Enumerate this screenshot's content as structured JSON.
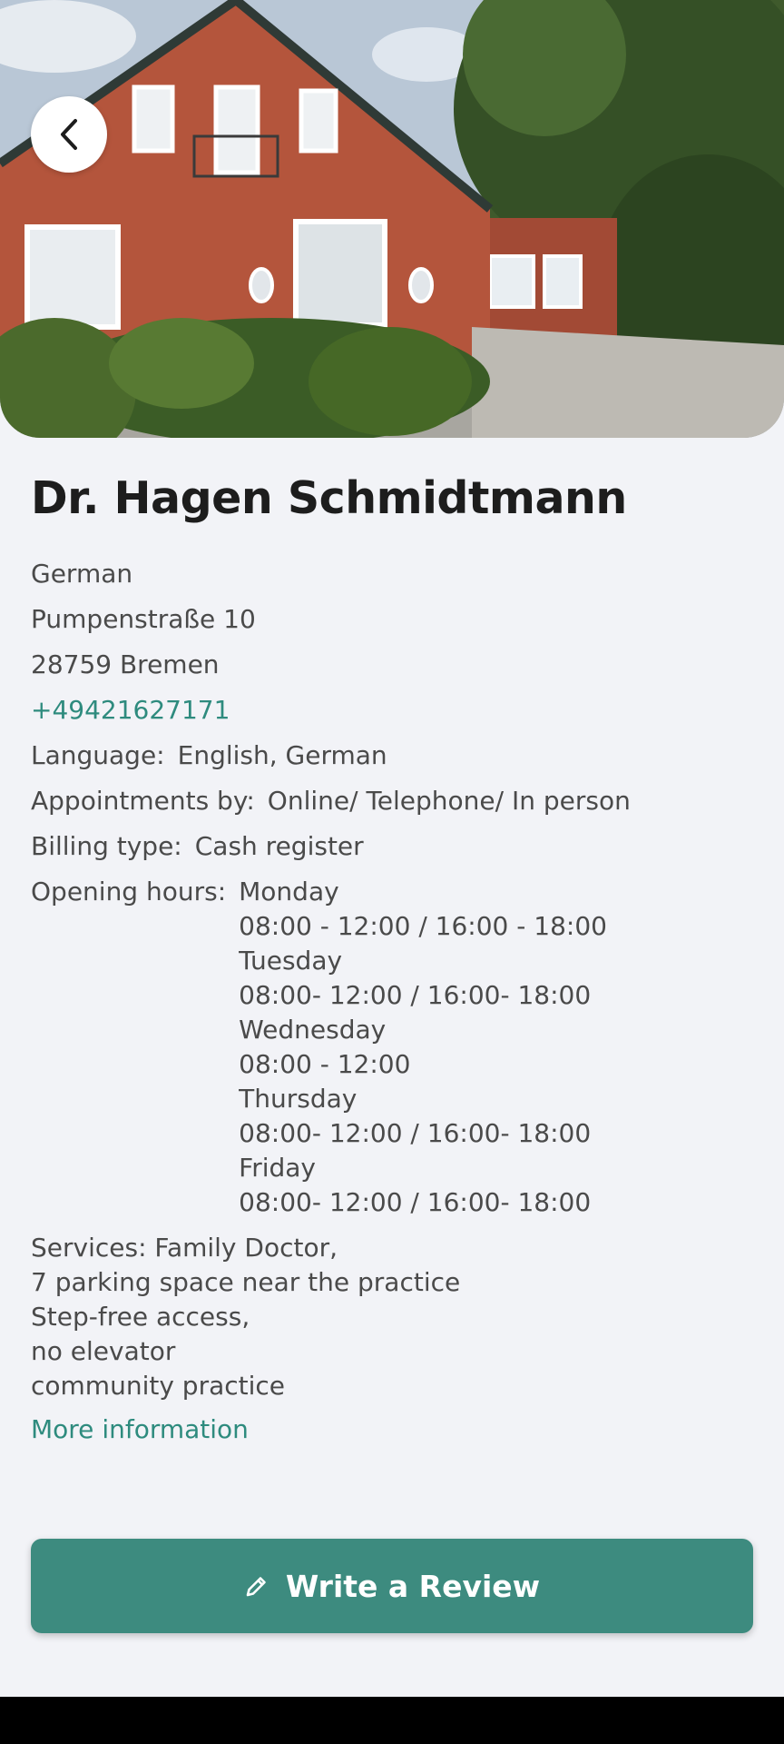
{
  "doctor": {
    "name": "Dr. Hagen Schmidtmann",
    "specialty": "German",
    "street": "Pumpenstraße 10",
    "city": "28759 Bremen",
    "phone": "+49421627171"
  },
  "details": {
    "language_label": "Language:",
    "language_value": "English, German",
    "appointments_label": "Appointments by:",
    "appointments_value": "Online/ Telephone/ In person",
    "billing_label": "Billing type:",
    "billing_value": "Cash register",
    "hours_label": "Opening hours:",
    "hours": [
      {
        "day": "Monday",
        "time": "08:00 - 12:00 / 16:00 - 18:00"
      },
      {
        "day": "Tuesday",
        "time": "08:00- 12:00 / 16:00- 18:00"
      },
      {
        "day": "Wednesday",
        "time": "08:00 - 12:00"
      },
      {
        "day": "Thursday",
        "time": "08:00- 12:00 / 16:00- 18:00"
      },
      {
        "day": "Friday",
        "time": "08:00- 12:00 / 16:00- 18:00"
      }
    ]
  },
  "services": [
    "Services: Family Doctor,",
    "7 parking space near the practice",
    "Step-free access,",
    "no elevator",
    "community practice"
  ],
  "links": {
    "more_info": "More information"
  },
  "actions": {
    "write_review": "Write a Review"
  },
  "icons": {
    "back": "chevron-left-icon",
    "review": "pencil-icon"
  },
  "colors": {
    "accent": "#3d8b7f",
    "link": "#2e8b7e",
    "background": "#f2f3f7"
  }
}
